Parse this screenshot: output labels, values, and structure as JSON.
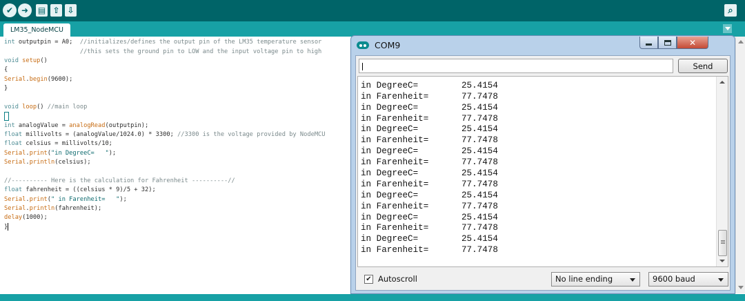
{
  "toolbar": {
    "buttons": [
      {
        "name": "verify",
        "glyph": "✔"
      },
      {
        "name": "upload",
        "glyph": "➜"
      },
      {
        "name": "new",
        "glyph": "▤"
      },
      {
        "name": "open",
        "glyph": "⇧"
      },
      {
        "name": "save",
        "glyph": "⇩"
      }
    ],
    "serial_monitor_glyph": "⌕"
  },
  "tabs": {
    "active": "LM35_NodeMCU"
  },
  "editor": {
    "lines": [
      "int outputpin = A0;  //initializes/defines the output pin of the LM35 temperature sensor",
      "                     //this sets the ground pin to LOW and the input voltage pin to high",
      "void setup()",
      "{",
      "Serial.begin(9600);",
      "}",
      "",
      "void loop() //main loop",
      "",
      "int analogValue = analogRead(outputpin);",
      "float millivolts = (analogValue/1024.0) * 3300; //3300 is the voltage provided by NodeMCU",
      "float celsius = millivolts/10;",
      "Serial.print(\"in DegreeC=   \");",
      "Serial.println(celsius);",
      "",
      "//---------- Here is the calculation for Fahrenheit ----------//",
      "float fahrenheit = ((celsius * 9)/5 + 32);",
      "Serial.print(\" in Farenheit=   \");",
      "Serial.println(fahrenheit);",
      "delay(1000);",
      "}"
    ]
  },
  "serial_monitor": {
    "title": "COM9",
    "close_glyph": "✕",
    "input_value": "",
    "send_label": "Send",
    "output": [
      {
        "label": "in Farenheit=",
        "value": "77.7478"
      },
      {
        "label": "in DegreeC=",
        "value": "25.4154"
      },
      {
        "label": "in Farenheit=",
        "value": "77.7478"
      },
      {
        "label": "in DegreeC=",
        "value": "25.4154"
      },
      {
        "label": "in Farenheit=",
        "value": "77.7478"
      },
      {
        "label": "in DegreeC=",
        "value": "25.4154"
      },
      {
        "label": "in Farenheit=",
        "value": "77.7478"
      },
      {
        "label": "in DegreeC=",
        "value": "25.4154"
      },
      {
        "label": "in Farenheit=",
        "value": "77.7478"
      },
      {
        "label": "in DegreeC=",
        "value": "25.4154"
      },
      {
        "label": "in Farenheit=",
        "value": "77.7478"
      },
      {
        "label": "in DegreeC=",
        "value": "25.4154"
      },
      {
        "label": "in Farenheit=",
        "value": "77.7478"
      },
      {
        "label": "in DegreeC=",
        "value": "25.4154"
      },
      {
        "label": "in Farenheit=",
        "value": "77.7478"
      },
      {
        "label": "in DegreeC=",
        "value": "25.4154"
      },
      {
        "label": "in Farenheit=",
        "value": "77.7478"
      }
    ],
    "autoscroll_label": "Autoscroll",
    "autoscroll_checked": true,
    "line_ending": "No line ending",
    "baud": "9600 baud"
  },
  "colors": {
    "toolbar": "#006468",
    "tabbar": "#17a1a5",
    "keyword": "#4e8c94",
    "function": "#c76c13",
    "comment": "#7b8a8c"
  }
}
